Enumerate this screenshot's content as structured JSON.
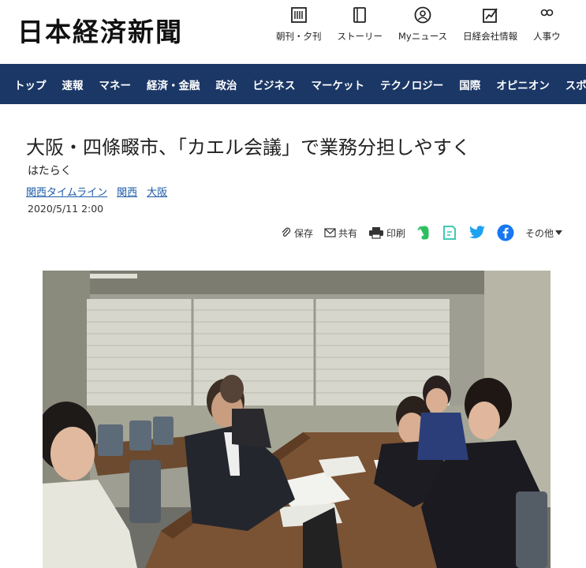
{
  "header": {
    "logo": "日本経済新聞",
    "nav": [
      {
        "label": "朝刊・夕刊",
        "icon": "newspaper-icon"
      },
      {
        "label": "ストーリー",
        "icon": "book-icon"
      },
      {
        "label": "Myニュース",
        "icon": "user-icon"
      },
      {
        "label": "日経会社情報",
        "icon": "chart-icon"
      },
      {
        "label": "人事ウ",
        "icon": "people-icon"
      }
    ]
  },
  "categories": [
    "トップ",
    "速報",
    "マネー",
    "経済・金融",
    "政治",
    "ビジネス",
    "マーケット",
    "テクノロジー",
    "国際",
    "オピニオン",
    "スポ"
  ],
  "article": {
    "title": "大阪・四條畷市、「カエル会議」で業務分担しやすく",
    "subtitle": "はたらく",
    "tags": [
      "関西タイムライン",
      "関西",
      "大阪"
    ],
    "date": "2020/5/11 2:00"
  },
  "share": {
    "save": "保存",
    "share": "共有",
    "print": "印刷",
    "more": "その他"
  },
  "colors": {
    "nav_bg": "#1b3766",
    "link": "#1e5ca8",
    "twitter": "#1da1f2",
    "facebook": "#1877f2",
    "evernote": "#2dbe60"
  }
}
